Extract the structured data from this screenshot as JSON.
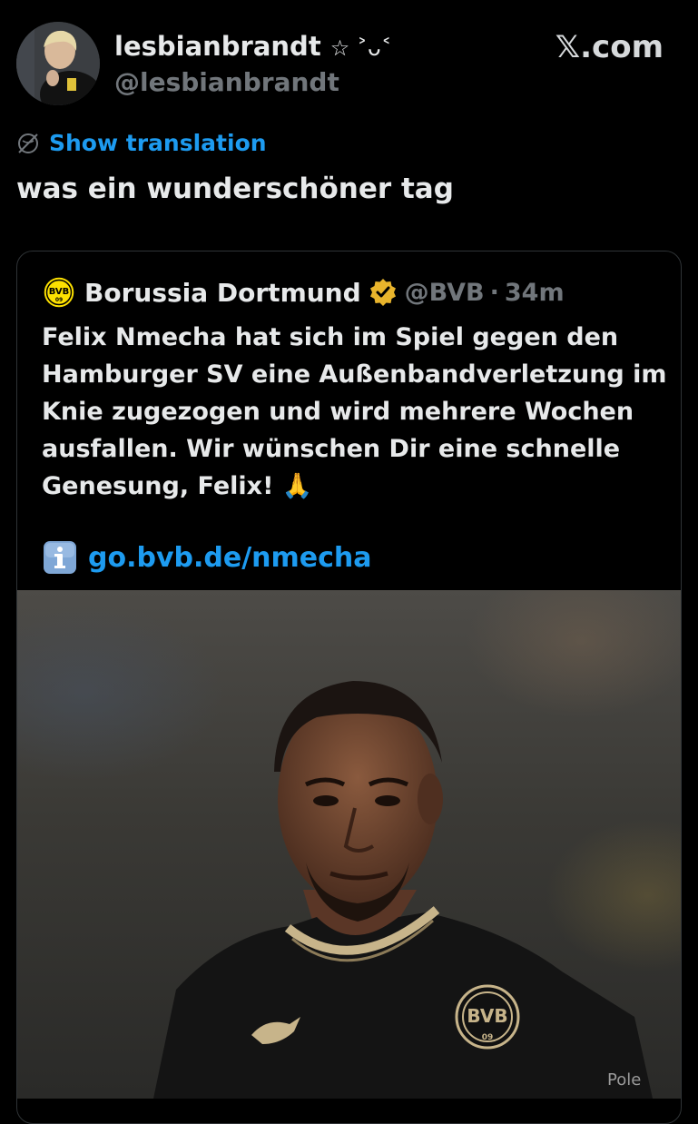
{
  "author": {
    "display_name": "lesbianbrandt",
    "name_decoration": "☆ ˃ᴗ˂",
    "handle": "@lesbianbrandt",
    "avatar": "avatar-photo"
  },
  "brand": {
    "label": "𝕏.com"
  },
  "translation": {
    "label": "Show translation",
    "icon": "translate-globe-icon"
  },
  "tweet": {
    "text": "was ein wunderschöner tag"
  },
  "quoted": {
    "name": "Borussia Dortmund",
    "handle": "@BVB",
    "separator": "·",
    "time": "34m",
    "verified": true,
    "logo": "bvb-logo",
    "logo_text": "BVB",
    "logo_subtext": "09",
    "text": "Felix Nmecha hat sich im Spiel gegen den Hamburger SV eine Außenbandverletzung im Knie zugezogen und wird mehrere Wochen ausfallen. Wir wünschen Dir eine schnelle Genesung, Felix! 🙏",
    "link_icon": "info-icon",
    "link": "go.bvb.de/nmecha",
    "photo_badge_text": "BVB",
    "photo_badge_subtext": "09",
    "photo_sponsor_text": "Pole"
  },
  "colors": {
    "background": "#000000",
    "accent_link": "#1d9bf0",
    "secondary_text": "#71767b",
    "verified_gold": "#e8b42c",
    "bvb_yellow": "#fde100"
  }
}
